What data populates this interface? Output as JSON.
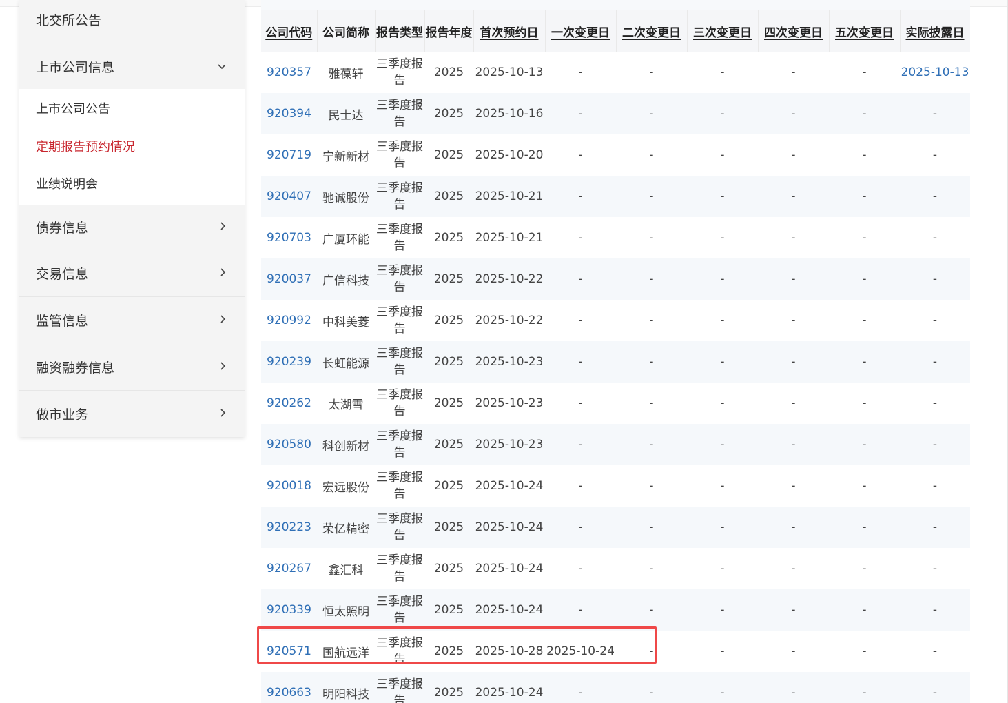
{
  "sidebar": {
    "top_item": "北交所公告",
    "expanded_section": {
      "label": "上市公司信息",
      "arrow": "chevron-down-icon"
    },
    "sub_items": [
      {
        "label": "上市公司公告",
        "active": false
      },
      {
        "label": "定期报告预约情况",
        "active": true
      },
      {
        "label": "业绩说明会",
        "active": false
      }
    ],
    "sections": [
      {
        "label": "债券信息"
      },
      {
        "label": "交易信息"
      },
      {
        "label": "监管信息"
      },
      {
        "label": "融资融券信息"
      },
      {
        "label": "做市业务"
      }
    ],
    "active_color": "#c8262e"
  },
  "table": {
    "headers": [
      "公司代码",
      "公司简称",
      "报告类型",
      "报告年度",
      "首次预约日",
      "一次变更日",
      "二次变更日",
      "三次变更日",
      "四次变更日",
      "五次变更日",
      "实际披露日"
    ],
    "rows": [
      [
        "920357",
        "雅葆轩",
        "三季度报告",
        "2025",
        "2025-10-13",
        "-",
        "-",
        "-",
        "-",
        "-",
        "2025-10-13"
      ],
      [
        "920394",
        "民士达",
        "三季度报告",
        "2025",
        "2025-10-16",
        "-",
        "-",
        "-",
        "-",
        "-",
        "-"
      ],
      [
        "920719",
        "宁新新材",
        "三季度报告",
        "2025",
        "2025-10-20",
        "-",
        "-",
        "-",
        "-",
        "-",
        "-"
      ],
      [
        "920407",
        "驰诚股份",
        "三季度报告",
        "2025",
        "2025-10-21",
        "-",
        "-",
        "-",
        "-",
        "-",
        "-"
      ],
      [
        "920703",
        "广厦环能",
        "三季度报告",
        "2025",
        "2025-10-21",
        "-",
        "-",
        "-",
        "-",
        "-",
        "-"
      ],
      [
        "920037",
        "广信科技",
        "三季度报告",
        "2025",
        "2025-10-22",
        "-",
        "-",
        "-",
        "-",
        "-",
        "-"
      ],
      [
        "920992",
        "中科美菱",
        "三季度报告",
        "2025",
        "2025-10-22",
        "-",
        "-",
        "-",
        "-",
        "-",
        "-"
      ],
      [
        "920239",
        "长虹能源",
        "三季度报告",
        "2025",
        "2025-10-23",
        "-",
        "-",
        "-",
        "-",
        "-",
        "-"
      ],
      [
        "920262",
        "太湖雪",
        "三季度报告",
        "2025",
        "2025-10-23",
        "-",
        "-",
        "-",
        "-",
        "-",
        "-"
      ],
      [
        "920580",
        "科创新材",
        "三季度报告",
        "2025",
        "2025-10-23",
        "-",
        "-",
        "-",
        "-",
        "-",
        "-"
      ],
      [
        "920018",
        "宏远股份",
        "三季度报告",
        "2025",
        "2025-10-24",
        "-",
        "-",
        "-",
        "-",
        "-",
        "-"
      ],
      [
        "920223",
        "荣亿精密",
        "三季度报告",
        "2025",
        "2025-10-24",
        "-",
        "-",
        "-",
        "-",
        "-",
        "-"
      ],
      [
        "920267",
        "鑫汇科",
        "三季度报告",
        "2025",
        "2025-10-24",
        "-",
        "-",
        "-",
        "-",
        "-",
        "-"
      ],
      [
        "920339",
        "恒太照明",
        "三季度报告",
        "2025",
        "2025-10-24",
        "-",
        "-",
        "-",
        "-",
        "-",
        "-"
      ],
      [
        "920571",
        "国航远洋",
        "三季度报告",
        "2025",
        "2025-10-28",
        "2025-10-24",
        "-",
        "-",
        "-",
        "-",
        "-"
      ],
      [
        "920663",
        "明阳科技",
        "三季度报告",
        "2025",
        "2025-10-24",
        "-",
        "-",
        "-",
        "-",
        "-",
        "-"
      ]
    ],
    "highlighted_row": 14,
    "highlight_color": "#ef4848",
    "link_color": "#2f6fb6"
  }
}
